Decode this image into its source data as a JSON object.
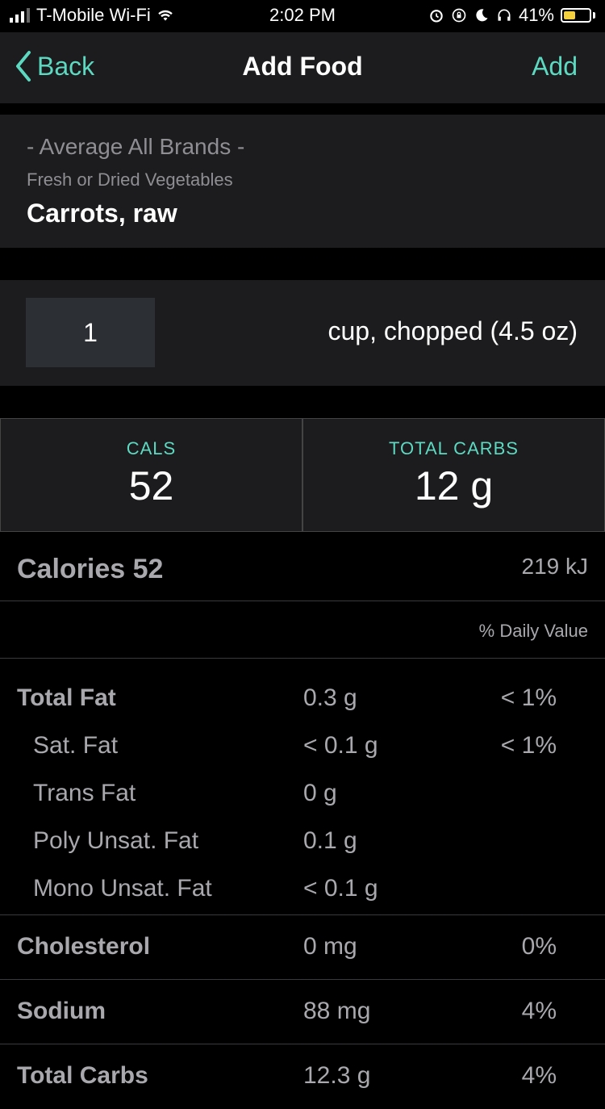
{
  "status_bar": {
    "carrier": "T-Mobile Wi-Fi",
    "time": "2:02 PM",
    "battery": "41%"
  },
  "nav": {
    "back_label": "Back",
    "title": "Add Food",
    "add_label": "Add",
    "accent_color": "#5dd9c1"
  },
  "food": {
    "brand": "- Average All Brands -",
    "category": "Fresh or Dried Vegetables",
    "name": "Carrots, raw"
  },
  "serving": {
    "quantity": "1",
    "unit": "cup, chopped (4.5 oz)"
  },
  "summary": [
    {
      "label": "CALS",
      "value": "52"
    },
    {
      "label": "TOTAL CARBS",
      "value": "12 g"
    }
  ],
  "nutrition": {
    "calories_label": "Calories 52",
    "kj": "219 kJ",
    "dv_header": "% Daily Value",
    "fat_group": [
      {
        "name": "Total Fat",
        "amount": "0.3 g",
        "dv": "< 1%"
      },
      {
        "name": "Sat. Fat",
        "amount": "< 0.1 g",
        "dv": "< 1%"
      },
      {
        "name": "Trans Fat",
        "amount": "0 g",
        "dv": ""
      },
      {
        "name": "Poly Unsat. Fat",
        "amount": "0.1 g",
        "dv": ""
      },
      {
        "name": "Mono Unsat. Fat",
        "amount": "< 0.1 g",
        "dv": ""
      }
    ],
    "cholesterol": {
      "name": "Cholesterol",
      "amount": "0 mg",
      "dv": "0%"
    },
    "sodium": {
      "name": "Sodium",
      "amount": "88 mg",
      "dv": "4%"
    },
    "total_carbs": {
      "name": "Total Carbs",
      "amount": "12.3 g",
      "dv": "4%"
    }
  }
}
